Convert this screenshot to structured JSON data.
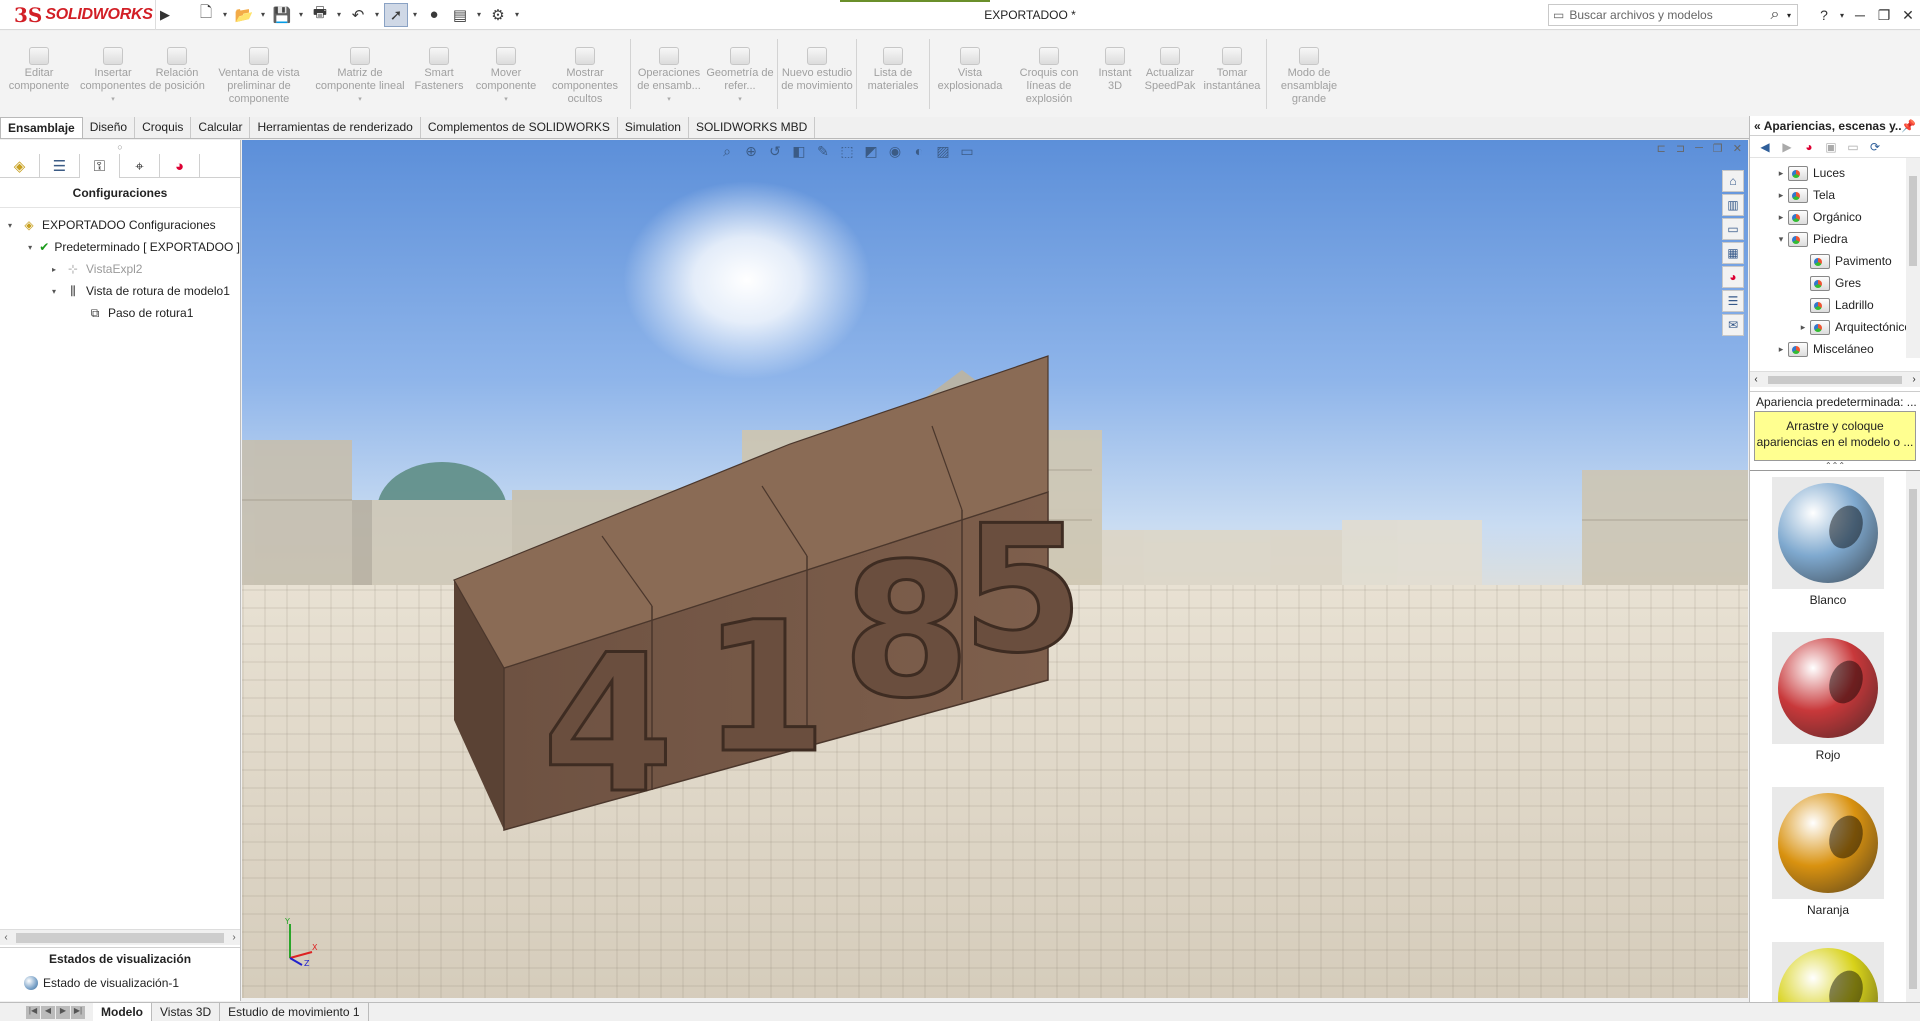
{
  "app": {
    "logo_prefix": "3S",
    "logo_text": "SOLIDWORKS",
    "doc_title": "EXPORTADOO *"
  },
  "search": {
    "placeholder": "Buscar archivos y modelos"
  },
  "commands": [
    {
      "label": "Editar componente",
      "icon": "edit-component-icon",
      "has_arrow": false
    },
    {
      "label": "Insertar componentes",
      "icon": "insert-components-icon",
      "has_arrow": true
    },
    {
      "label": "Relación de posición",
      "icon": "mate-icon",
      "has_arrow": false
    },
    {
      "label": "Ventana de vista preliminar de componente",
      "icon": "preview-window-icon",
      "has_arrow": false
    },
    {
      "label": "Matriz de componente lineal",
      "icon": "linear-pattern-icon",
      "has_arrow": true
    },
    {
      "label": "Smart Fasteners",
      "icon": "smart-fasteners-icon",
      "has_arrow": false
    },
    {
      "label": "Mover componente",
      "icon": "move-component-icon",
      "has_arrow": true
    },
    {
      "label": "Mostrar componentes ocultos",
      "icon": "show-hidden-icon",
      "has_arrow": false
    },
    {
      "label": "Operaciones de ensamb...",
      "icon": "assembly-features-icon",
      "has_arrow": true
    },
    {
      "label": "Geometría de refer...",
      "icon": "reference-geometry-icon",
      "has_arrow": true
    },
    {
      "label": "Nuevo estudio de movimiento",
      "icon": "motion-study-icon",
      "has_arrow": false
    },
    {
      "label": "Lista de materiales",
      "icon": "bom-icon",
      "has_arrow": false
    },
    {
      "label": "Vista explosionada",
      "icon": "exploded-view-icon",
      "has_arrow": false
    },
    {
      "label": "Croquis con líneas de explosión",
      "icon": "explode-line-sketch-icon",
      "has_arrow": false
    },
    {
      "label": "Instant 3D",
      "icon": "instant3d-icon",
      "has_arrow": false
    },
    {
      "label": "Actualizar SpeedPak",
      "icon": "speedpak-icon",
      "has_arrow": false
    },
    {
      "label": "Tomar instantánea",
      "icon": "snapshot-icon",
      "has_arrow": false
    },
    {
      "label": "Modo de ensamblaje grande",
      "icon": "large-assembly-icon",
      "has_arrow": false
    }
  ],
  "tabs": [
    "Ensamblaje",
    "Diseño",
    "Croquis",
    "Calcular",
    "Herramientas de renderizado",
    "Complementos de SOLIDWORKS",
    "Simulation",
    "SOLIDWORKS MBD"
  ],
  "active_tab": "Ensamblaje",
  "left_panel": {
    "title": "Configuraciones",
    "tree": [
      {
        "label": "EXPORTADOO Configuraciones",
        "level": 0,
        "expander": "▾",
        "icon": "assembly-icon",
        "dim": false
      },
      {
        "label": "Predeterminado [ EXPORTADOO ]",
        "level": 1,
        "expander": "▾",
        "icon": "config-check-icon",
        "dim": false
      },
      {
        "label": "VistaExpl2",
        "level": 2,
        "expander": "▸",
        "icon": "exploded-view-icon",
        "dim": true
      },
      {
        "label": "Vista de rotura de modelo1",
        "level": 2,
        "expander": "▾",
        "icon": "break-view-icon",
        "dim": false
      },
      {
        "label": "Paso de rotura1",
        "level": 3,
        "expander": "",
        "icon": "break-step-icon",
        "dim": false
      }
    ],
    "display_states_title": "Estados de visualización",
    "display_state": "Estado de visualización-1"
  },
  "viewport": {
    "model_digits": [
      "4",
      "1",
      "8",
      "5"
    ],
    "model_color": "#7a5a47",
    "triad": {
      "x": "X",
      "y": "Y",
      "z": "Z"
    }
  },
  "right_panel": {
    "title": "Apariencias, escenas y...",
    "tree": [
      {
        "label": "Luces",
        "level": 0,
        "expander": "▸"
      },
      {
        "label": "Tela",
        "level": 0,
        "expander": "▸"
      },
      {
        "label": "Orgánico",
        "level": 0,
        "expander": "▸"
      },
      {
        "label": "Piedra",
        "level": 0,
        "expander": "▾"
      },
      {
        "label": "Pavimento",
        "level": 1,
        "expander": ""
      },
      {
        "label": "Gres",
        "level": 1,
        "expander": ""
      },
      {
        "label": "Ladrillo",
        "level": 1,
        "expander": ""
      },
      {
        "label": "Arquitectónico",
        "level": 1,
        "expander": "▸"
      },
      {
        "label": "Misceláneo",
        "level": 0,
        "expander": "▸"
      }
    ],
    "default_label": "Apariencia predeterminada: ...",
    "tip": "Arrastre y coloque apariencias en el modelo o ...",
    "swatches": [
      {
        "name": "Blanco",
        "color": "#7fa9cf"
      },
      {
        "name": "Rojo",
        "color": "#c8383a"
      },
      {
        "name": "Naranja",
        "color": "#d99210"
      },
      {
        "name": "",
        "color": "#d8d21a"
      }
    ]
  },
  "bottom_tabs": [
    "Modelo",
    "Vistas 3D",
    "Estudio de movimiento 1"
  ],
  "active_bottom_tab": "Modelo"
}
